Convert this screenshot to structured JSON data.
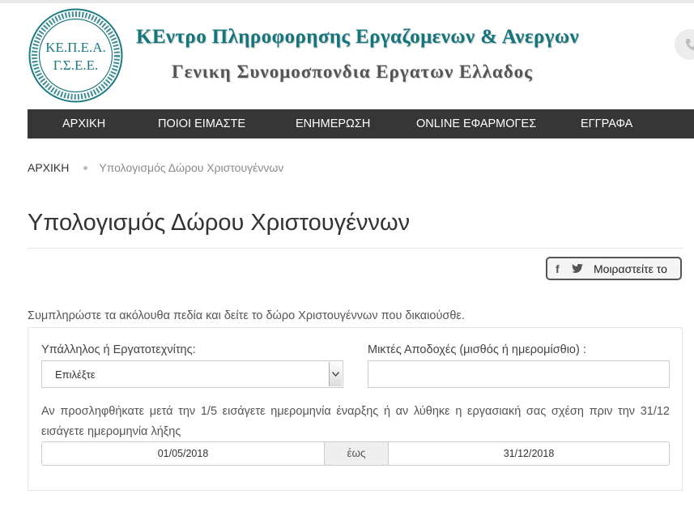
{
  "header": {
    "logo_text": "ΚΕ.Π.Ε.Α. Γ.Σ.Ε.Ε.",
    "logo_ring_text": "ΚΕΝΤΡΟ ΠΛΗΡΟΦΟΡΗΣΗΣ ΕΡΓΑΖΟΜΕΝΩΝ & ΑΝΕΡΓΩΝ",
    "title": "ΚΕντρο Πληροφορησης Εργαζομενων & Ανεργων",
    "subtitle": "Γενικη Συνομοσπονδια Εργατων Ελλαδος",
    "phone_icon": "phone-icon"
  },
  "nav": {
    "items": [
      "ΑΡΧΙΚΗ",
      "ΠΟΙΟΙ ΕΙΜΑΣΤΕ",
      "ΕΝΗΜΕΡΩΣΗ",
      "ONLINE ΕΦΑΡΜΟΓΕΣ",
      "ΕΓΓΡΑΦΑ"
    ]
  },
  "breadcrumb": {
    "home": "ΑΡΧΙΚΗ",
    "current": "Υπολογισμός Δώρου Χριστουγέννων"
  },
  "page": {
    "title": "Υπολογισμός Δώρου Χριστουγέννων",
    "share_label": "Μοιραστείτε το",
    "intro": "Συμπληρώστε τα ακόλουθα πεδία και δείτε το δώρο Χριστουγέννων που δικαιούσθε."
  },
  "form": {
    "employee_type_label": "Υπάλληλος ή Εργατοτεχνίτης:",
    "employee_type_value": "Επιλέξτε",
    "wage_label": "Μικτές Αποδοχές (μισθός ή ημερομίσθιο) :",
    "wage_value": "",
    "dates_note": "Αν προσληφθήκατε μετά την 1/5 εισάγετε ημερομηνία έναρξης ή αν λύθηκε η εργασιακή σας σχέση πριν την 31/12 εισάγετε ημερομηνία λήξης",
    "date_from": "01/05/2018",
    "date_sep": "έως",
    "date_to": "31/12/2018"
  },
  "colors": {
    "brand": "#13767d",
    "nav_bg": "#363636"
  }
}
